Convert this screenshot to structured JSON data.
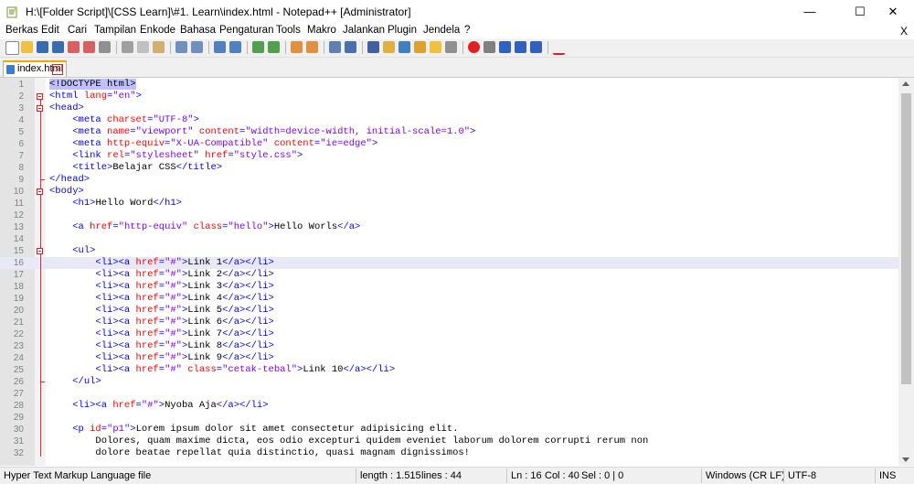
{
  "window": {
    "title": "H:\\[Folder Script]\\[CSS Learn]\\#1. Learn\\index.html - Notepad++ [Administrator]",
    "minimize_glyph": "—",
    "maximize_glyph": "☐",
    "close_glyph": "✕"
  },
  "menu": {
    "items": [
      "Berkas",
      "Edit",
      "Cari",
      "Tampilan",
      "Enkode",
      "Bahasa",
      "Pengaturan",
      "Tools",
      "Makro",
      "Jalankan",
      "Plugin",
      "Jendela",
      "?"
    ],
    "doc_close": "X"
  },
  "toolbar": {
    "icons": [
      "new-file-icon",
      "open-file-icon",
      "save-icon",
      "save-all-icon",
      "close-icon",
      "close-all-icon",
      "print-icon",
      "cut-icon",
      "copy-icon",
      "paste-icon",
      "undo-icon",
      "redo-icon",
      "find-icon",
      "replace-icon",
      "zoom-in-icon",
      "zoom-out-icon",
      "sync-vertical-icon",
      "sync-horizontal-icon",
      "word-wrap-icon",
      "show-all-chars-icon",
      "indent-guide-icon",
      "udl-icon",
      "doc-map-icon",
      "function-list-icon",
      "folder-workspace-icon",
      "monitoring-icon",
      "record-macro-icon",
      "stop-record-icon",
      "play-macro-icon",
      "run-macro-multiple-icon",
      "save-macro-icon",
      "spell-check-icon"
    ]
  },
  "tab": {
    "label": "index.html"
  },
  "editor": {
    "current_line": 16,
    "lines": [
      {
        "n": "1",
        "tokens": [
          [
            "doc",
            "<!DOCTYPE html>"
          ]
        ]
      },
      {
        "n": "2",
        "tokens": [
          [
            "tag",
            "<html "
          ],
          [
            "attr",
            "lang"
          ],
          [
            "tag",
            "="
          ],
          [
            "val",
            "\"en\""
          ],
          [
            "tag",
            ">"
          ]
        ]
      },
      {
        "n": "3",
        "tokens": [
          [
            "tag",
            "<head>"
          ]
        ]
      },
      {
        "n": "4",
        "tokens": [
          [
            "text",
            "    "
          ],
          [
            "tag",
            "<meta "
          ],
          [
            "attr",
            "charset"
          ],
          [
            "tag",
            "="
          ],
          [
            "val",
            "\"UTF-8\""
          ],
          [
            "tag",
            ">"
          ]
        ]
      },
      {
        "n": "5",
        "tokens": [
          [
            "text",
            "    "
          ],
          [
            "tag",
            "<meta "
          ],
          [
            "attr",
            "name"
          ],
          [
            "tag",
            "="
          ],
          [
            "val",
            "\"viewport\""
          ],
          [
            "tag",
            " "
          ],
          [
            "attr",
            "content"
          ],
          [
            "tag",
            "="
          ],
          [
            "val",
            "\"width=device-width, initial-scale=1.0\""
          ],
          [
            "tag",
            ">"
          ]
        ]
      },
      {
        "n": "6",
        "tokens": [
          [
            "text",
            "    "
          ],
          [
            "tag",
            "<meta "
          ],
          [
            "attr",
            "http-equiv"
          ],
          [
            "tag",
            "="
          ],
          [
            "val",
            "\"X-UA-Compatible\""
          ],
          [
            "tag",
            " "
          ],
          [
            "attr",
            "content"
          ],
          [
            "tag",
            "="
          ],
          [
            "val",
            "\"ie=edge\""
          ],
          [
            "tag",
            ">"
          ]
        ]
      },
      {
        "n": "7",
        "tokens": [
          [
            "text",
            "    "
          ],
          [
            "tag",
            "<link "
          ],
          [
            "attr",
            "rel"
          ],
          [
            "tag",
            "="
          ],
          [
            "val",
            "\"stylesheet\""
          ],
          [
            "tag",
            " "
          ],
          [
            "attr",
            "href"
          ],
          [
            "tag",
            "="
          ],
          [
            "val",
            "\"style.css\""
          ],
          [
            "tag",
            ">"
          ]
        ]
      },
      {
        "n": "8",
        "tokens": [
          [
            "text",
            "    "
          ],
          [
            "tag",
            "<title>"
          ],
          [
            "text",
            "Belajar CSS"
          ],
          [
            "tag",
            "</title>"
          ]
        ]
      },
      {
        "n": "9",
        "tokens": [
          [
            "tag",
            "</head>"
          ]
        ]
      },
      {
        "n": "10",
        "tokens": [
          [
            "tag",
            "<body>"
          ]
        ]
      },
      {
        "n": "11",
        "tokens": [
          [
            "text",
            "    "
          ],
          [
            "tag",
            "<h1>"
          ],
          [
            "text",
            "Hello Word"
          ],
          [
            "tag",
            "</h1>"
          ]
        ]
      },
      {
        "n": "12",
        "tokens": []
      },
      {
        "n": "13",
        "tokens": [
          [
            "text",
            "    "
          ],
          [
            "tag",
            "<a "
          ],
          [
            "attr",
            "href"
          ],
          [
            "tag",
            "="
          ],
          [
            "val",
            "\"http-equiv\""
          ],
          [
            "tag",
            " "
          ],
          [
            "attr",
            "class"
          ],
          [
            "tag",
            "="
          ],
          [
            "val",
            "\"hello\""
          ],
          [
            "tag",
            ">"
          ],
          [
            "text",
            "Hello Worls"
          ],
          [
            "tag",
            "</a>"
          ]
        ]
      },
      {
        "n": "14",
        "tokens": []
      },
      {
        "n": "15",
        "tokens": [
          [
            "text",
            "    "
          ],
          [
            "tag",
            "<ul>"
          ]
        ]
      },
      {
        "n": "16",
        "tokens": [
          [
            "text",
            "        "
          ],
          [
            "tag",
            "<li><a "
          ],
          [
            "attr",
            "href"
          ],
          [
            "tag",
            "="
          ],
          [
            "val",
            "\"#\""
          ],
          [
            "tag",
            ">"
          ],
          [
            "text",
            "Link 1"
          ],
          [
            "tag",
            "</a></li>"
          ]
        ]
      },
      {
        "n": "17",
        "tokens": [
          [
            "text",
            "        "
          ],
          [
            "tag",
            "<li><a "
          ],
          [
            "attr",
            "href"
          ],
          [
            "tag",
            "="
          ],
          [
            "val",
            "\"#\""
          ],
          [
            "tag",
            ">"
          ],
          [
            "text",
            "Link 2"
          ],
          [
            "tag",
            "</a></li>"
          ]
        ]
      },
      {
        "n": "18",
        "tokens": [
          [
            "text",
            "        "
          ],
          [
            "tag",
            "<li><a "
          ],
          [
            "attr",
            "href"
          ],
          [
            "tag",
            "="
          ],
          [
            "val",
            "\"#\""
          ],
          [
            "tag",
            ">"
          ],
          [
            "text",
            "Link 3"
          ],
          [
            "tag",
            "</a></li>"
          ]
        ]
      },
      {
        "n": "19",
        "tokens": [
          [
            "text",
            "        "
          ],
          [
            "tag",
            "<li><a "
          ],
          [
            "attr",
            "href"
          ],
          [
            "tag",
            "="
          ],
          [
            "val",
            "\"#\""
          ],
          [
            "tag",
            ">"
          ],
          [
            "text",
            "Link 4"
          ],
          [
            "tag",
            "</a></li>"
          ]
        ]
      },
      {
        "n": "20",
        "tokens": [
          [
            "text",
            "        "
          ],
          [
            "tag",
            "<li><a "
          ],
          [
            "attr",
            "href"
          ],
          [
            "tag",
            "="
          ],
          [
            "val",
            "\"#\""
          ],
          [
            "tag",
            ">"
          ],
          [
            "text",
            "Link 5"
          ],
          [
            "tag",
            "</a></li>"
          ]
        ]
      },
      {
        "n": "21",
        "tokens": [
          [
            "text",
            "        "
          ],
          [
            "tag",
            "<li><a "
          ],
          [
            "attr",
            "href"
          ],
          [
            "tag",
            "="
          ],
          [
            "val",
            "\"#\""
          ],
          [
            "tag",
            ">"
          ],
          [
            "text",
            "Link 6"
          ],
          [
            "tag",
            "</a></li>"
          ]
        ]
      },
      {
        "n": "22",
        "tokens": [
          [
            "text",
            "        "
          ],
          [
            "tag",
            "<li><a "
          ],
          [
            "attr",
            "href"
          ],
          [
            "tag",
            "="
          ],
          [
            "val",
            "\"#\""
          ],
          [
            "tag",
            ">"
          ],
          [
            "text",
            "Link 7"
          ],
          [
            "tag",
            "</a></li>"
          ]
        ]
      },
      {
        "n": "23",
        "tokens": [
          [
            "text",
            "        "
          ],
          [
            "tag",
            "<li><a "
          ],
          [
            "attr",
            "href"
          ],
          [
            "tag",
            "="
          ],
          [
            "val",
            "\"#\""
          ],
          [
            "tag",
            ">"
          ],
          [
            "text",
            "Link 8"
          ],
          [
            "tag",
            "</a></li>"
          ]
        ]
      },
      {
        "n": "24",
        "tokens": [
          [
            "text",
            "        "
          ],
          [
            "tag",
            "<li><a "
          ],
          [
            "attr",
            "href"
          ],
          [
            "tag",
            "="
          ],
          [
            "val",
            "\"#\""
          ],
          [
            "tag",
            ">"
          ],
          [
            "text",
            "Link 9"
          ],
          [
            "tag",
            "</a></li>"
          ]
        ]
      },
      {
        "n": "25",
        "tokens": [
          [
            "text",
            "        "
          ],
          [
            "tag",
            "<li><a "
          ],
          [
            "attr",
            "href"
          ],
          [
            "tag",
            "="
          ],
          [
            "val",
            "\"#\""
          ],
          [
            "tag",
            " "
          ],
          [
            "attr",
            "class"
          ],
          [
            "tag",
            "="
          ],
          [
            "val",
            "\"cetak-tebal\""
          ],
          [
            "tag",
            ">"
          ],
          [
            "text",
            "Link 10"
          ],
          [
            "tag",
            "</a></li>"
          ]
        ]
      },
      {
        "n": "26",
        "tokens": [
          [
            "text",
            "    "
          ],
          [
            "tag",
            "</ul>"
          ]
        ]
      },
      {
        "n": "27",
        "tokens": []
      },
      {
        "n": "28",
        "tokens": [
          [
            "text",
            "    "
          ],
          [
            "tag",
            "<li><a "
          ],
          [
            "attr",
            "href"
          ],
          [
            "tag",
            "="
          ],
          [
            "val",
            "\"#\""
          ],
          [
            "tag",
            ">"
          ],
          [
            "text",
            "Nyoba Aja"
          ],
          [
            "tag",
            "</a></li>"
          ]
        ]
      },
      {
        "n": "29",
        "tokens": []
      },
      {
        "n": "30",
        "tokens": [
          [
            "text",
            "    "
          ],
          [
            "tag",
            "<p "
          ],
          [
            "attr",
            "id"
          ],
          [
            "tag",
            "="
          ],
          [
            "val",
            "\"p1\""
          ],
          [
            "tag",
            ">"
          ],
          [
            "text",
            "Lorem ipsum dolor sit amet consectetur adipisicing elit."
          ]
        ]
      },
      {
        "n": "31",
        "tokens": [
          [
            "text",
            "        Dolores, quam maxime dicta, eos odio excepturi quidem eveniet laborum dolorem corrupti rerum non"
          ]
        ]
      },
      {
        "n": "32",
        "tokens": [
          [
            "text",
            "        dolore beatae repellat quia distinctio, quasi magnam dignissimos!"
          ]
        ]
      }
    ]
  },
  "status": {
    "file_type": "Hyper Text Markup Language file",
    "length": "length : 1.515",
    "lines": "lines : 44",
    "ln": "Ln : 16",
    "col": "Col : 40",
    "sel": "Sel : 0 | 0",
    "eol": "Windows (CR LF)",
    "encoding": "UTF-8",
    "mode": "INS"
  },
  "colors": {
    "tag": "#0000ff",
    "attr": "#ff0000",
    "value": "#8000ff",
    "tab_accent": "#f7a500",
    "current_line": "#e8e8f6"
  }
}
